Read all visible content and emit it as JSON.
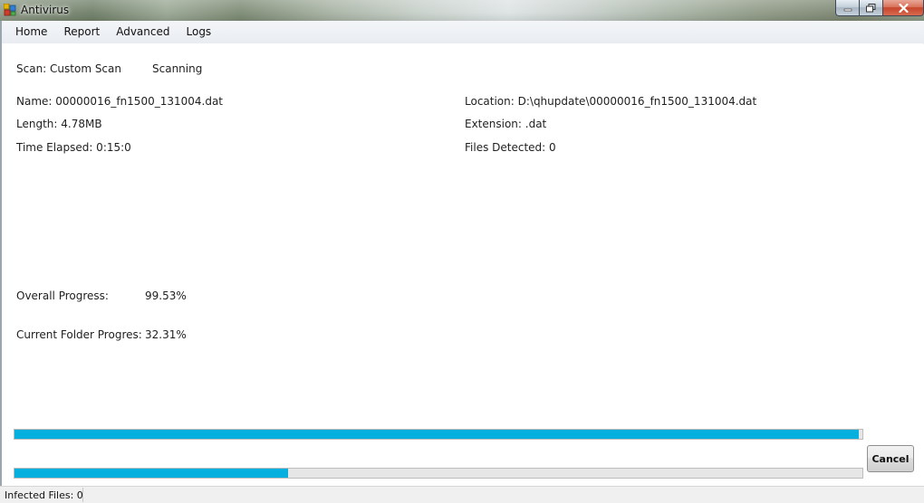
{
  "window": {
    "title": "Antivirus"
  },
  "menu": {
    "items": [
      "Home",
      "Report",
      "Advanced",
      "Logs"
    ]
  },
  "scan": {
    "type_label": "Scan: Custom Scan",
    "state": "Scanning"
  },
  "file": {
    "name": "Name: 00000016_fn1500_131004.dat",
    "length": "Length: 4.78MB",
    "time_elapsed": "Time Elapsed: 0:15:0",
    "location": "Location: D:\\qhupdate\\00000016_fn1500_131004.dat",
    "extension": "Extension: .dat",
    "files_detected": "Files Detected: 0"
  },
  "progress": {
    "overall_label": "Overall Progress:",
    "overall_value": "99.53%",
    "overall_fraction": 0.9953,
    "folder_label": "Current Folder Progres:",
    "folder_value": "32.31%",
    "folder_fraction": 0.3231
  },
  "buttons": {
    "cancel": "Cancel"
  },
  "status": {
    "infected": "Infected Files: 0"
  },
  "colors": {
    "progress_fill": "#06b0de"
  }
}
